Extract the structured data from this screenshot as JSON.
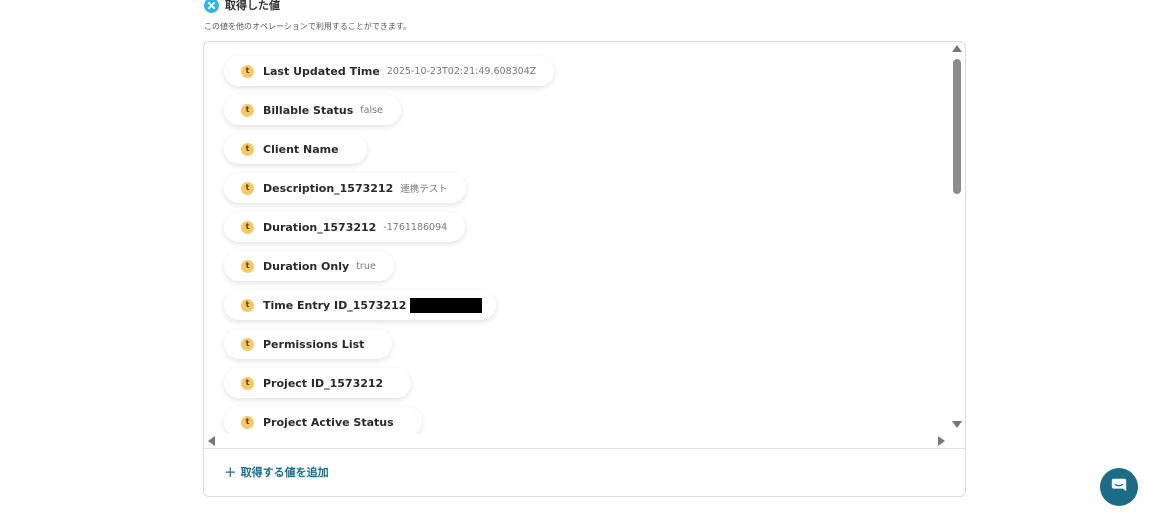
{
  "section": {
    "title": "取得した値",
    "description": "この値を他のオペレーションで利用することができます。"
  },
  "items": [
    {
      "label": "Last Updated Time",
      "value": "2025-10-23T02:21:49.608304Z"
    },
    {
      "label": "Billable Status",
      "value": "false"
    },
    {
      "label": "Client Name",
      "value": ""
    },
    {
      "label": "Description_1573212",
      "value": "連携テスト"
    },
    {
      "label": "Duration_1573212",
      "value": "-1761186094"
    },
    {
      "label": "Duration Only",
      "value": "true"
    },
    {
      "label": "Time Entry ID_1573212",
      "value": ""
    },
    {
      "label": "Permissions List",
      "value": ""
    },
    {
      "label": "Project ID_1573212",
      "value": ""
    },
    {
      "label": "Project Active Status",
      "value": ""
    }
  ],
  "item_icon_text": "t",
  "add_button": {
    "label": "取得する値を追加"
  },
  "colors": {
    "accent": "#1a6e8e",
    "item_icon_bg": "#f5c96a",
    "header_icon": "#2fb6e6",
    "chat_button": "#1b6c86"
  },
  "icons": {
    "header": "close-circle-icon",
    "item": "toggl-app-icon",
    "add": "plus-icon",
    "chat": "chat-bubble-icon"
  }
}
